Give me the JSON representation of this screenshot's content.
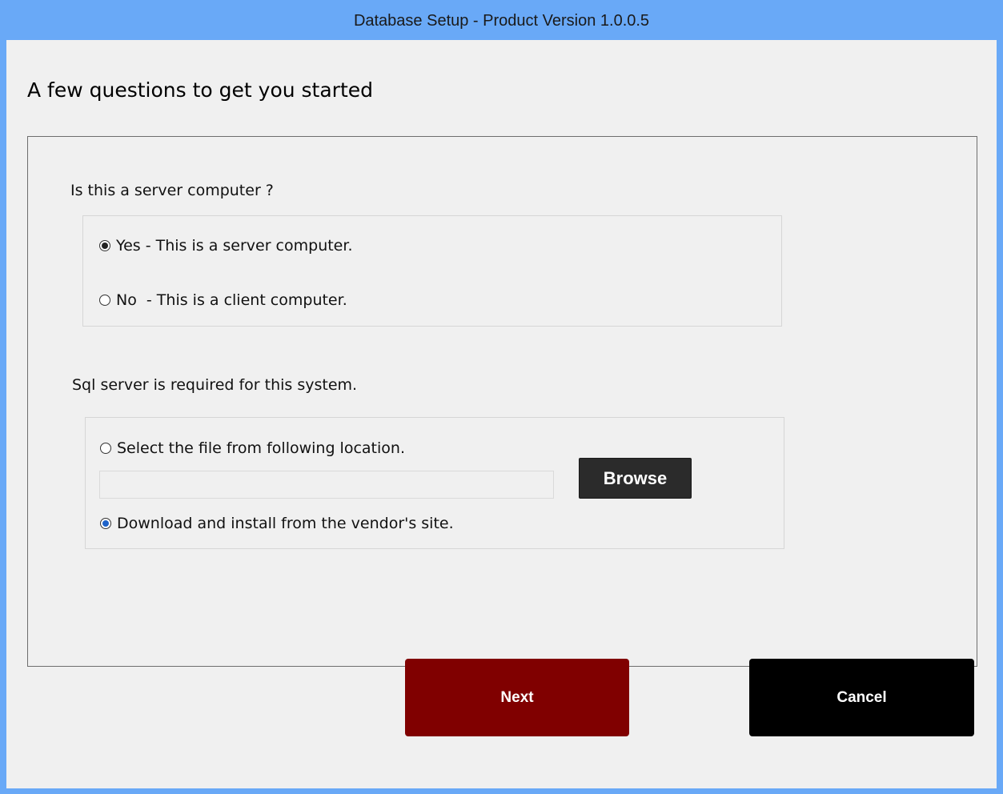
{
  "window": {
    "title": "Database Setup - Product Version 1.0.0.5"
  },
  "page": {
    "heading": "A few questions to get you started"
  },
  "server_question": {
    "label": "Is this a server computer ?",
    "options": [
      {
        "label": "Yes - This is a server computer.",
        "checked": true
      },
      {
        "label": "No  - This is a client computer.",
        "checked": false
      }
    ]
  },
  "sql_question": {
    "label": "Sql server is required for this system.",
    "options": [
      {
        "label": "Select the file from following location.",
        "checked": false
      },
      {
        "label": "Download and install from the vendor's site.",
        "checked": true
      }
    ],
    "file_path_value": "",
    "browse_label": "Browse"
  },
  "buttons": {
    "next_label": "Next",
    "cancel_label": "Cancel"
  },
  "colors": {
    "titlebar": "#69a9f7",
    "next_button": "#800000",
    "cancel_button": "#000000",
    "browse_button": "#2b2b2b",
    "selected_radio_accent": "#1e63c9"
  }
}
